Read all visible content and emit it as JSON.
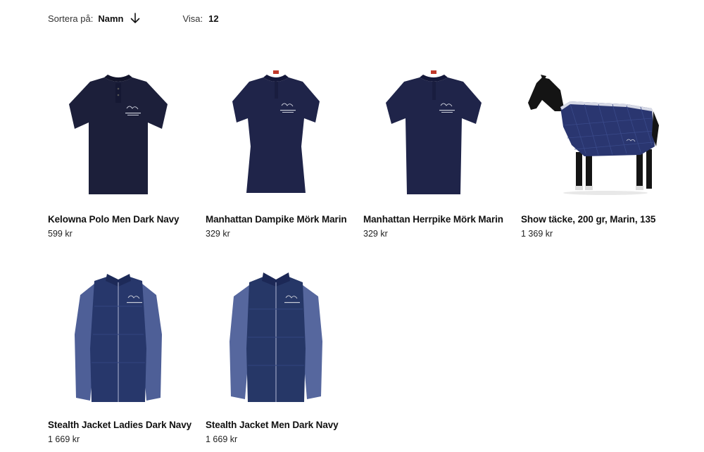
{
  "toolbar": {
    "sort_label": "Sortera på:",
    "sort_value": "Namn",
    "show_label": "Visa:",
    "show_value": "12"
  },
  "products": [
    {
      "name": "Kelowna Polo Men Dark Navy",
      "price": "599 kr",
      "image": "polo-shirt-men"
    },
    {
      "name": "Manhattan Dampike Mörk Marin",
      "price": "329 kr",
      "image": "pique-women"
    },
    {
      "name": "Manhattan Herrpike Mörk Marin",
      "price": "329 kr",
      "image": "pique-men"
    },
    {
      "name": "Show täcke, 200 gr, Marin, 135",
      "price": "1 369 kr",
      "image": "horse-rug"
    },
    {
      "name": "Stealth Jacket Ladies Dark Navy",
      "price": "1 669 kr",
      "image": "jacket-ladies"
    },
    {
      "name": "Stealth Jacket Men Dark Navy",
      "price": "1 669 kr",
      "image": "jacket-men"
    }
  ]
}
